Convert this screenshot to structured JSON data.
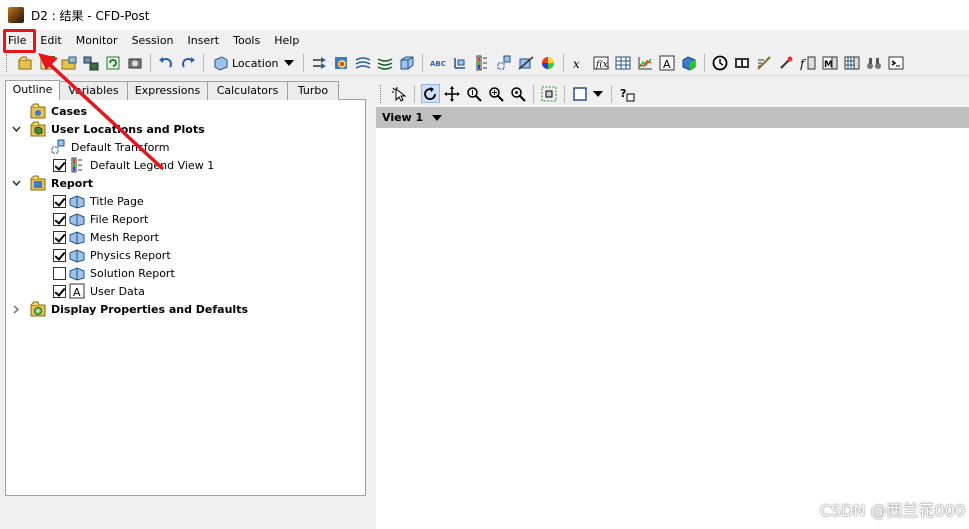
{
  "window": {
    "title": "D2 : 结果 - CFD-Post"
  },
  "menubar": {
    "items": [
      "File",
      "Edit",
      "Monitor",
      "Session",
      "Insert",
      "Tools",
      "Help"
    ]
  },
  "toolbar": {
    "location_label": "Location"
  },
  "left_panel": {
    "tabs": [
      "Outline",
      "Variables",
      "Expressions",
      "Calculators",
      "Turbo"
    ],
    "active_tab": "Outline",
    "tree": {
      "cases": "Cases",
      "user_locations": "User Locations and Plots",
      "default_transform": "Default Transform",
      "default_legend": "Default Legend View 1",
      "report": "Report",
      "report_items": [
        {
          "label": "Title Page",
          "checked": true
        },
        {
          "label": "File Report",
          "checked": true
        },
        {
          "label": "Mesh Report",
          "checked": true
        },
        {
          "label": "Physics Report",
          "checked": true
        },
        {
          "label": "Solution Report",
          "checked": false
        },
        {
          "label": "User Data",
          "checked": true
        }
      ],
      "display_props": "Display Properties and Defaults"
    }
  },
  "viewer": {
    "view_label": "View 1"
  },
  "watermark": "CSDN @西兰花000",
  "colors": {
    "highlight": "#e8141c",
    "view_header": "#c0c0c0"
  }
}
